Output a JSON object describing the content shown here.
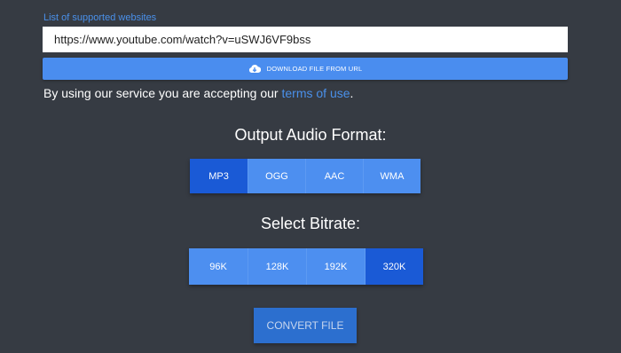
{
  "links": {
    "supported_websites": "List of supported websites"
  },
  "url_input": {
    "value": "https://www.youtube.com/watch?v=uSWJ6VF9bss",
    "placeholder": ""
  },
  "download_button": {
    "label": "DOWNLOAD FILE FROM URL",
    "icon": "cloud-download-icon"
  },
  "terms": {
    "prefix": "By using our service you are accepting our ",
    "link": "terms of use",
    "suffix": "."
  },
  "output_format": {
    "heading": "Output Audio Format:",
    "options": [
      "MP3",
      "OGG",
      "AAC",
      "WMA"
    ],
    "selected": "MP3"
  },
  "bitrate": {
    "heading": "Select Bitrate:",
    "options": [
      "96K",
      "128K",
      "192K",
      "320K"
    ],
    "selected": "320K"
  },
  "convert_button": {
    "label": "CONVERT FILE"
  },
  "colors": {
    "background": "#363b43",
    "accent": "#4a8def",
    "selected": "#1a5ad6",
    "link": "#4a90ea"
  }
}
